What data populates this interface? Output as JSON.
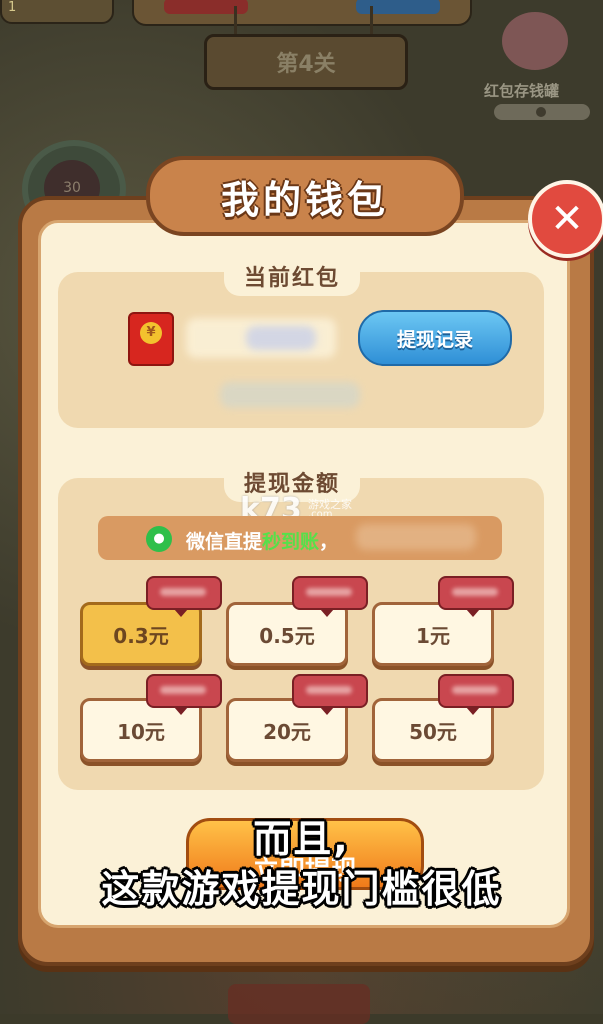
{
  "hud": {
    "level_label": "第4关",
    "piggy_bank_label": "红包存钱罐",
    "clock_value": "30",
    "top_left_value": "1"
  },
  "modal": {
    "title": "我的钱包",
    "close_symbol": "✕"
  },
  "current_packet": {
    "section_title": "当前红包",
    "coin_symbol": "¥",
    "record_button": "提现记录"
  },
  "withdraw": {
    "section_title": "提现金额",
    "wechat_icon": "wechat-icon",
    "wechat_text_prefix": "微信直提",
    "wechat_text_highlight": "秒到账",
    "wechat_text_suffix": "，",
    "amounts": [
      {
        "label": "0.3元",
        "selected": true
      },
      {
        "label": "0.5元",
        "selected": false
      },
      {
        "label": "1元",
        "selected": false
      },
      {
        "label": "10元",
        "selected": false
      },
      {
        "label": "20元",
        "selected": false
      },
      {
        "label": "50元",
        "selected": false
      }
    ],
    "submit_button": "立即提现"
  },
  "watermark": {
    "brand": "k73",
    "sub": "游戏之家",
    "url": ".com"
  },
  "subtitles": {
    "line1": "而且,",
    "line2": "这款游戏提现门槛很低"
  },
  "colors": {
    "accent_orange": "#f07a1a",
    "wechat_green": "#2fbf4a",
    "close_red": "#e14a3f",
    "record_blue": "#2f8fd6"
  }
}
